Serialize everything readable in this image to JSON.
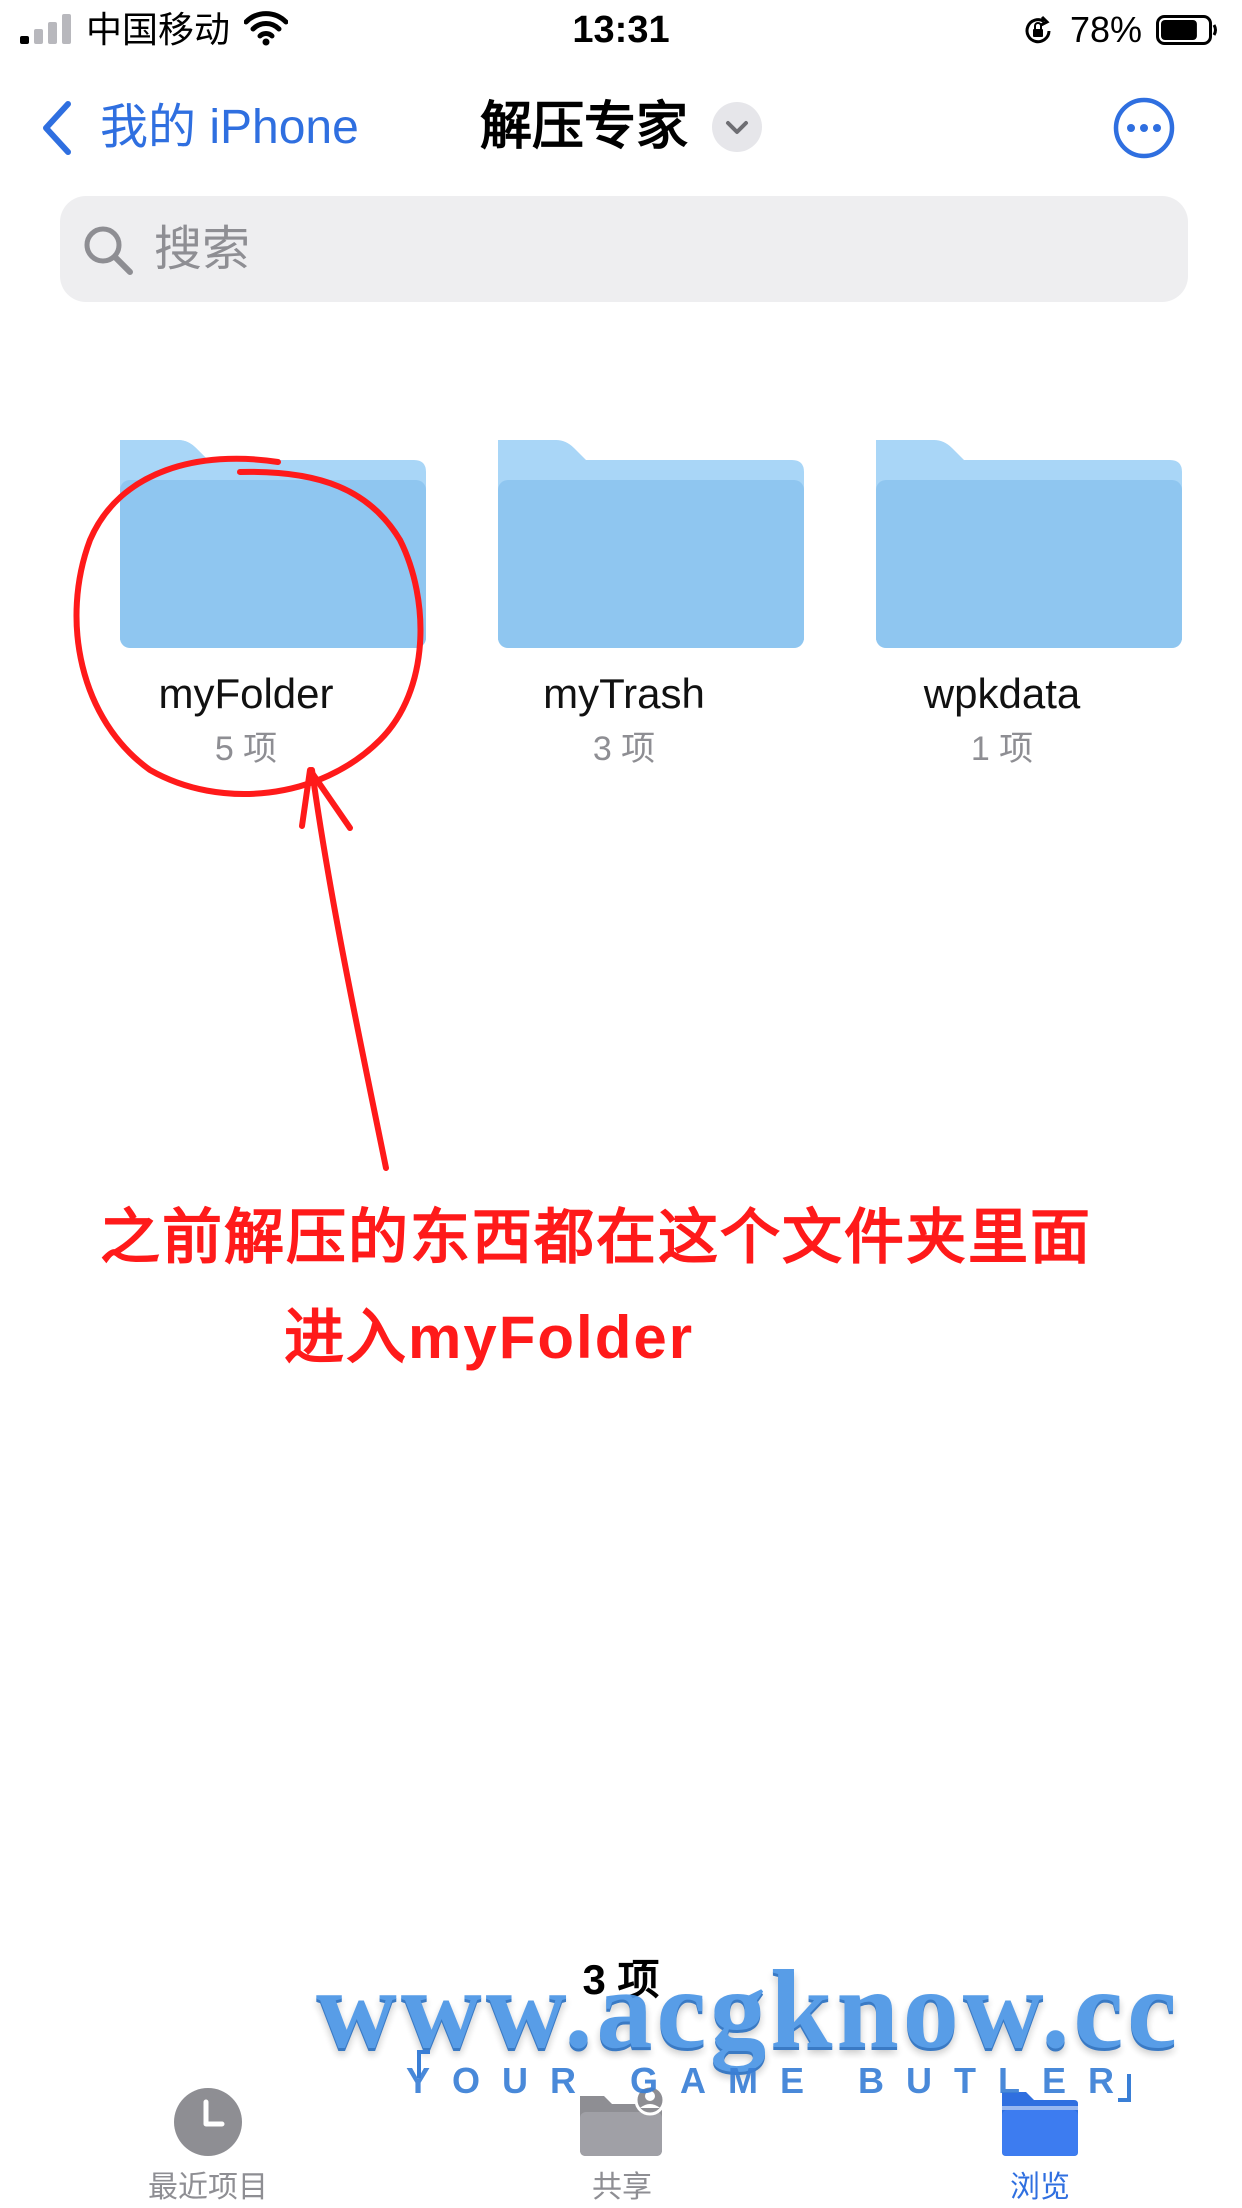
{
  "status_bar": {
    "carrier": "中国移动",
    "time": "13:31",
    "battery_percent": "78%",
    "battery_level": 0.78
  },
  "nav": {
    "back_label": "我的 iPhone",
    "title": "解压专家",
    "title_menu_icon": "chevron-down-icon",
    "more_icon": "ellipsis-circle-icon"
  },
  "search": {
    "placeholder": "搜索",
    "value": ""
  },
  "folders": [
    {
      "name": "myFolder",
      "count": "5 项"
    },
    {
      "name": "myTrash",
      "count": "3 项"
    },
    {
      "name": "wpkdata",
      "count": "1 项"
    }
  ],
  "annotation": {
    "line1": "之前解压的东西都在这个文件夹里面",
    "line2": "进入myFolder",
    "color": "#ff1a1a"
  },
  "item_count": "3 项",
  "watermark": {
    "url": "www.acgknow.cc",
    "slogan": "YOUR GAME BUTLER"
  },
  "tabs": [
    {
      "label": "最近项目",
      "icon": "clock-icon",
      "active": false
    },
    {
      "label": "共享",
      "icon": "shared-folder-icon",
      "active": false
    },
    {
      "label": "浏览",
      "icon": "browse-folder-icon",
      "active": true
    }
  ],
  "colors": {
    "accent": "#2f6fe0",
    "folder": "#8fc6f0",
    "folder_tab": "#a9d6f7",
    "secondary_text": "#8e8e93"
  }
}
